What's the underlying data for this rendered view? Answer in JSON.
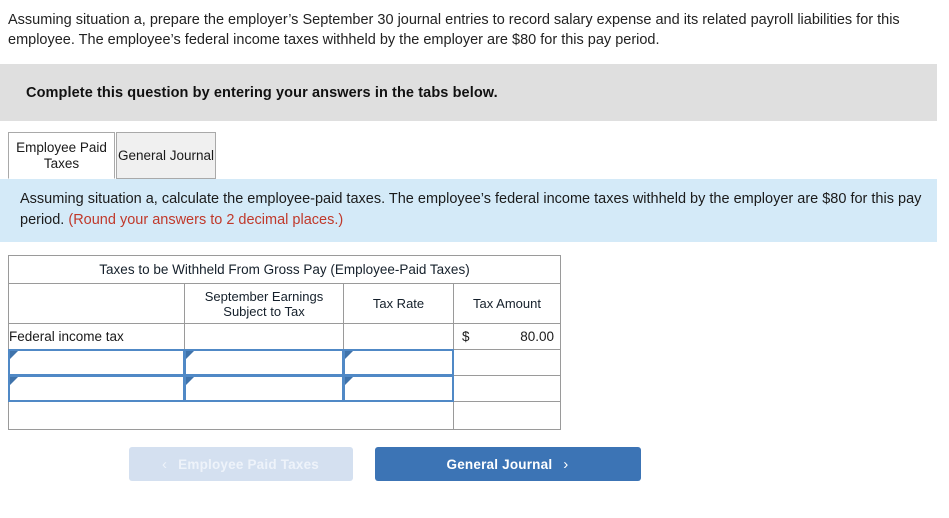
{
  "prompt": {
    "text": "Assuming situation a, prepare the employer’s September 30 journal entries to record salary expense and its related payroll liabilities for this employee. The employee’s federal income taxes withheld by the employer are $80 for this pay period."
  },
  "banner": {
    "text": "Complete this question by entering your answers in the tabs below."
  },
  "tabs": [
    {
      "label": "Employee Paid Taxes",
      "active": true
    },
    {
      "label": "General Journal",
      "active": false
    }
  ],
  "info": {
    "text": "Assuming situation a, calculate the employee-paid taxes. The employee’s federal income taxes withheld by the employer are $80 for this pay period. ",
    "note": "(Round your answers to 2 decimal places.)",
    "note_color": "#c0392b",
    "background": "#d4eaf8"
  },
  "worksheet": {
    "title": "Taxes to be Withheld From Gross Pay (Employee-Paid Taxes)",
    "header_color": "#76ace6",
    "columns": [
      "",
      "September Earnings Subject to Tax",
      "Tax Rate",
      "Tax Amount"
    ],
    "column_lines": [
      [
        "",
        ""
      ],
      [
        "September Earnings",
        "Subject to Tax"
      ],
      [
        "Tax Rate",
        ""
      ],
      [
        "Tax Amount",
        ""
      ]
    ],
    "rows": [
      {
        "type": "filled",
        "label": "Federal income tax",
        "earnings": "",
        "rate": "",
        "currency": "$",
        "amount": "80.00"
      },
      {
        "type": "input",
        "label": "",
        "earnings": "",
        "rate": "",
        "currency": "",
        "amount": ""
      },
      {
        "type": "input",
        "label": "",
        "earnings": "",
        "rate": "",
        "currency": "",
        "amount": ""
      }
    ],
    "total_row": {
      "label": "",
      "amount": ""
    }
  },
  "footer": {
    "prev_button": {
      "label": "Employee Paid Taxes",
      "icon": "chevron-left-icon",
      "glyph": "‹",
      "disabled": true,
      "background": "#d4e0f0"
    },
    "next_button": {
      "label": "General Journal",
      "icon": "chevron-right-icon",
      "glyph": "›",
      "disabled": false,
      "background": "#3c74b5"
    }
  }
}
